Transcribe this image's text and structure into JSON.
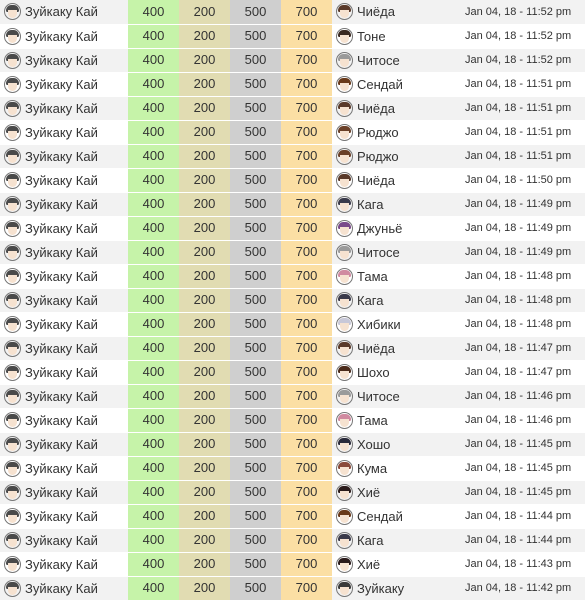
{
  "rows": [
    {
      "ship": "Зуйкаку Кай",
      "fuel": "400",
      "ammo": "200",
      "steel": "500",
      "baux": "700",
      "result": "Чиёда",
      "hair": "#5a3a2a",
      "time": "Jan 04, 18 - 11:52 pm"
    },
    {
      "ship": "Зуйкаку Кай",
      "fuel": "400",
      "ammo": "200",
      "steel": "500",
      "baux": "700",
      "result": "Тоне",
      "hair": "#3a2a22",
      "time": "Jan 04, 18 - 11:52 pm"
    },
    {
      "ship": "Зуйкаку Кай",
      "fuel": "400",
      "ammo": "200",
      "steel": "500",
      "baux": "700",
      "result": "Читосе",
      "hair": "#9a9a9a",
      "time": "Jan 04, 18 - 11:52 pm"
    },
    {
      "ship": "Зуйкаку Кай",
      "fuel": "400",
      "ammo": "200",
      "steel": "500",
      "baux": "700",
      "result": "Сендай",
      "hair": "#6a3a1a",
      "time": "Jan 04, 18 - 11:51 pm"
    },
    {
      "ship": "Зуйкаку Кай",
      "fuel": "400",
      "ammo": "200",
      "steel": "500",
      "baux": "700",
      "result": "Чиёда",
      "hair": "#5a3a2a",
      "time": "Jan 04, 18 - 11:51 pm"
    },
    {
      "ship": "Зуйкаку Кай",
      "fuel": "400",
      "ammo": "200",
      "steel": "500",
      "baux": "700",
      "result": "Рюджо",
      "hair": "#6a4028",
      "time": "Jan 04, 18 - 11:51 pm"
    },
    {
      "ship": "Зуйкаку Кай",
      "fuel": "400",
      "ammo": "200",
      "steel": "500",
      "baux": "700",
      "result": "Рюджо",
      "hair": "#6a4028",
      "time": "Jan 04, 18 - 11:51 pm"
    },
    {
      "ship": "Зуйкаку Кай",
      "fuel": "400",
      "ammo": "200",
      "steel": "500",
      "baux": "700",
      "result": "Чиёда",
      "hair": "#5a3a2a",
      "time": "Jan 04, 18 - 11:50 pm"
    },
    {
      "ship": "Зуйкаку Кай",
      "fuel": "400",
      "ammo": "200",
      "steel": "500",
      "baux": "700",
      "result": "Кага",
      "hair": "#3a3a4a",
      "time": "Jan 04, 18 - 11:49 pm"
    },
    {
      "ship": "Зуйкаку Кай",
      "fuel": "400",
      "ammo": "200",
      "steel": "500",
      "baux": "700",
      "result": "Джуньё",
      "hair": "#7a4a8a",
      "time": "Jan 04, 18 - 11:49 pm"
    },
    {
      "ship": "Зуйкаку Кай",
      "fuel": "400",
      "ammo": "200",
      "steel": "500",
      "baux": "700",
      "result": "Читосе",
      "hair": "#9a9a9a",
      "time": "Jan 04, 18 - 11:49 pm"
    },
    {
      "ship": "Зуйкаку Кай",
      "fuel": "400",
      "ammo": "200",
      "steel": "500",
      "baux": "700",
      "result": "Тама",
      "hair": "#d08aa0",
      "time": "Jan 04, 18 - 11:48 pm"
    },
    {
      "ship": "Зуйкаку Кай",
      "fuel": "400",
      "ammo": "200",
      "steel": "500",
      "baux": "700",
      "result": "Кага",
      "hair": "#3a3a4a",
      "time": "Jan 04, 18 - 11:48 pm"
    },
    {
      "ship": "Зуйкаку Кай",
      "fuel": "400",
      "ammo": "200",
      "steel": "500",
      "baux": "700",
      "result": "Хибики",
      "hair": "#c8c8d8",
      "time": "Jan 04, 18 - 11:48 pm"
    },
    {
      "ship": "Зуйкаку Кай",
      "fuel": "400",
      "ammo": "200",
      "steel": "500",
      "baux": "700",
      "result": "Чиёда",
      "hair": "#5a3a2a",
      "time": "Jan 04, 18 - 11:47 pm"
    },
    {
      "ship": "Зуйкаку Кай",
      "fuel": "400",
      "ammo": "200",
      "steel": "500",
      "baux": "700",
      "result": "Шохо",
      "hair": "#4a2a1a",
      "time": "Jan 04, 18 - 11:47 pm"
    },
    {
      "ship": "Зуйкаку Кай",
      "fuel": "400",
      "ammo": "200",
      "steel": "500",
      "baux": "700",
      "result": "Читосе",
      "hair": "#9a9a9a",
      "time": "Jan 04, 18 - 11:46 pm"
    },
    {
      "ship": "Зуйкаку Кай",
      "fuel": "400",
      "ammo": "200",
      "steel": "500",
      "baux": "700",
      "result": "Тама",
      "hair": "#d08aa0",
      "time": "Jan 04, 18 - 11:46 pm"
    },
    {
      "ship": "Зуйкаку Кай",
      "fuel": "400",
      "ammo": "200",
      "steel": "500",
      "baux": "700",
      "result": "Хошо",
      "hair": "#2a2a3a",
      "time": "Jan 04, 18 - 11:45 pm"
    },
    {
      "ship": "Зуйкаку Кай",
      "fuel": "400",
      "ammo": "200",
      "steel": "500",
      "baux": "700",
      "result": "Кума",
      "hair": "#8a4a3a",
      "time": "Jan 04, 18 - 11:45 pm"
    },
    {
      "ship": "Зуйкаку Кай",
      "fuel": "400",
      "ammo": "200",
      "steel": "500",
      "baux": "700",
      "result": "Хиё",
      "hair": "#2a1a1a",
      "time": "Jan 04, 18 - 11:45 pm"
    },
    {
      "ship": "Зуйкаку Кай",
      "fuel": "400",
      "ammo": "200",
      "steel": "500",
      "baux": "700",
      "result": "Сендай",
      "hair": "#6a3a1a",
      "time": "Jan 04, 18 - 11:44 pm"
    },
    {
      "ship": "Зуйкаку Кай",
      "fuel": "400",
      "ammo": "200",
      "steel": "500",
      "baux": "700",
      "result": "Кага",
      "hair": "#3a3a4a",
      "time": "Jan 04, 18 - 11:44 pm"
    },
    {
      "ship": "Зуйкаку Кай",
      "fuel": "400",
      "ammo": "200",
      "steel": "500",
      "baux": "700",
      "result": "Хиё",
      "hair": "#2a1a1a",
      "time": "Jan 04, 18 - 11:43 pm"
    },
    {
      "ship": "Зуйкаку Кай",
      "fuel": "400",
      "ammo": "200",
      "steel": "500",
      "baux": "700",
      "result": "Зуйкаку",
      "hair": "#3a3a3a",
      "time": "Jan 04, 18 - 11:42 pm"
    }
  ],
  "flagship_hair": "#4a4a4a"
}
